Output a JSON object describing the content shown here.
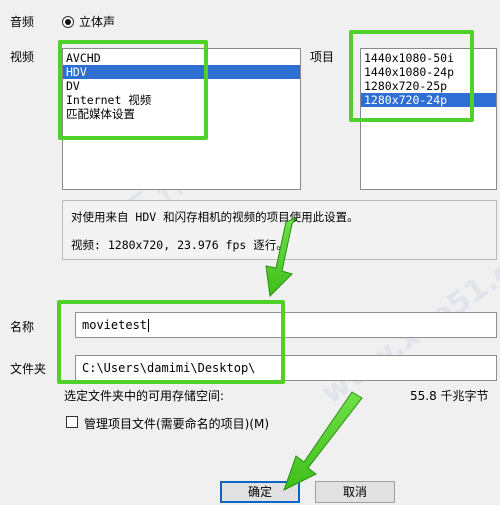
{
  "audio": {
    "label": "音频",
    "option_label": "立体声"
  },
  "video": {
    "label": "视频",
    "items": [
      "AVCHD",
      "HDV",
      "DV",
      "Internet 视频",
      "匹配媒体设置"
    ],
    "selected_index": 1
  },
  "project": {
    "label": "项目",
    "items": [
      "1440x1080-50i",
      "1440x1080-24p",
      "1280x720-25p",
      "1280x720-24p"
    ],
    "selected_index": 3
  },
  "description": {
    "line1": "对使用来自 HDV 和闪存相机的视频的项目使用此设置。",
    "line2": "视频: 1280x720, 23.976 fps 逐行。"
  },
  "name": {
    "label": "名称",
    "value": "movietest"
  },
  "folder": {
    "label": "文件夹",
    "value": "C:\\Users\\damimi\\Desktop\\"
  },
  "space": {
    "label": "选定文件夹中的可用存储空间:",
    "value": "55.8 千兆字节"
  },
  "manage": {
    "label": "管理项目文件(需要命名的项目)(M)",
    "checked": false
  },
  "buttons": {
    "ok": "确定",
    "cancel": "取消"
  },
  "colors": {
    "highlight": "#4fd12a",
    "selection": "#2f6fd4"
  }
}
